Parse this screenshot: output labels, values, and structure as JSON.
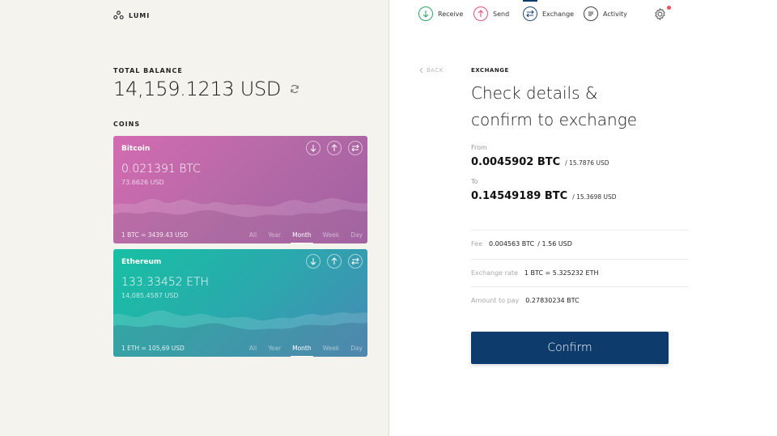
{
  "app": {
    "logo_text": "LUMI"
  },
  "balance": {
    "label": "TOTAL BALANCE",
    "value": "14,159.1213 USD"
  },
  "coins": {
    "label": "COINS",
    "items": [
      {
        "name": "Bitcoin",
        "amount": "0.021391 BTC",
        "usd": "73.6626 USD",
        "rate": "1 BTC = 3439.43 USD",
        "tabs": [
          "All",
          "Year",
          "Month",
          "Week",
          "Day"
        ],
        "active_tab": "Month"
      },
      {
        "name": "Ethereum",
        "amount": "133.33452 ETH",
        "usd": "14,085.4587 USD",
        "rate": "1 ETH = 105,69 USD",
        "tabs": [
          "All",
          "Year",
          "Month",
          "Week",
          "Day"
        ],
        "active_tab": "Month"
      }
    ]
  },
  "nav": {
    "receive": "Receive",
    "send": "Send",
    "exchange": "Exchange",
    "activity": "Activity",
    "active": "Exchange",
    "has_notification": true
  },
  "exchange": {
    "back": "BACK",
    "section_title": "EXCHANGE",
    "headline_line1": "Check details &",
    "headline_line2": "confirm to exchange",
    "from_label": "From",
    "from_amount": "0.0045902 BTC",
    "from_usd": "/ 15.7876 USD",
    "to_label": "To",
    "to_amount": "0.14549189 BTC",
    "to_usd": "/ 15.3698 USD",
    "fee_label": "Fee",
    "fee_value": "0.004563 BTC",
    "fee_usd": "/ 1.56 USD",
    "rate_label": "Exchange rate",
    "rate_value": "1 BTC = 5.325232 ETH",
    "pay_label": "Amount to pay",
    "pay_value": "0.27830234 BTC",
    "confirm_label": "Confirm"
  },
  "colors": {
    "primary": "#0d3c6c",
    "receive": "#2fa866",
    "send": "#e0507c",
    "notification": "#f0515f",
    "bitcoin_card": "#c46aad",
    "ethereum_card": "#2aa9ad"
  }
}
